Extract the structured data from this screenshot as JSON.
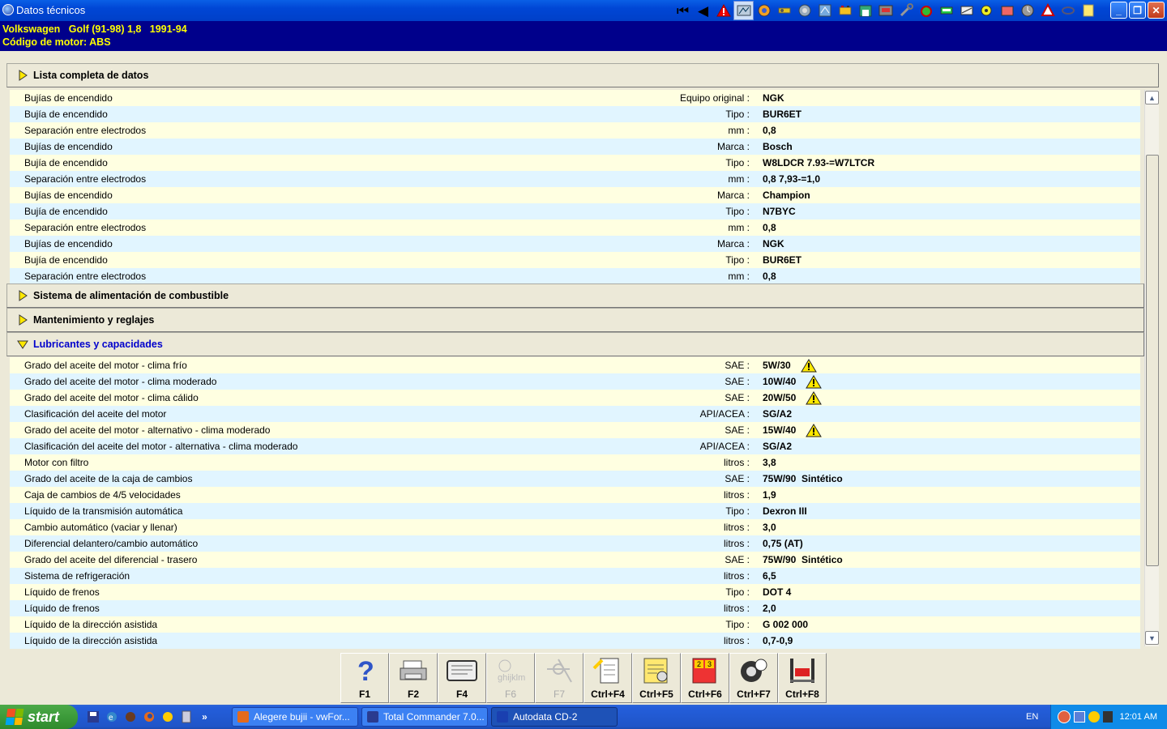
{
  "window": {
    "title": "Datos técnicos"
  },
  "toolbar": {
    "icons": [
      "first-page-icon",
      "previous-icon",
      "warning-icon",
      "diagram-icon",
      "engine-icon",
      "tools-icon",
      "disc-icon",
      "map-icon",
      "battery-icon",
      "garage-icon",
      "lift-icon",
      "wrench-icon",
      "electrical-icon",
      "car-icon",
      "belt-icon",
      "service-icon",
      "body-icon",
      "clock-icon",
      "triangle-icon",
      "chain-icon",
      "notes-icon"
    ]
  },
  "vehicle": {
    "line1": "Volkswagen   Golf (91-98) 1,8   1991-94",
    "line2": "Código de motor: ABS"
  },
  "sections": {
    "complete": "Lista completa de datos",
    "fuel": "Sistema de alimentación de combustible",
    "maintenance": "Mantenimiento y reglajes",
    "lubricants": "Lubricantes y capacidades"
  },
  "spark_rows": [
    {
      "name": "Bujías de encendido",
      "unit": "Equipo original :",
      "value": "NGK",
      "warn": false
    },
    {
      "name": "Bujía de encendido",
      "unit": "Tipo :",
      "value": "BUR6ET",
      "warn": false
    },
    {
      "name": "Separación entre electrodos",
      "unit": "mm :",
      "value": "0,8",
      "warn": false
    },
    {
      "name": "Bujías de encendido",
      "unit": "Marca :",
      "value": "Bosch",
      "warn": false
    },
    {
      "name": "Bujía de encendido",
      "unit": "Tipo :",
      "value": "W8LDCR 7.93-=W7LTCR",
      "warn": false
    },
    {
      "name": "Separación entre electrodos",
      "unit": "mm :",
      "value": "0,8 7,93-=1,0",
      "warn": false
    },
    {
      "name": "Bujías de encendido",
      "unit": "Marca :",
      "value": "Champion",
      "warn": false
    },
    {
      "name": "Bujía de encendido",
      "unit": "Tipo :",
      "value": "N7BYC",
      "warn": false
    },
    {
      "name": "Separación entre electrodos",
      "unit": "mm :",
      "value": "0,8",
      "warn": false
    },
    {
      "name": "Bujías de encendido",
      "unit": "Marca :",
      "value": "NGK",
      "warn": false
    },
    {
      "name": "Bujía de encendido",
      "unit": "Tipo :",
      "value": "BUR6ET",
      "warn": false
    },
    {
      "name": "Separación entre electrodos",
      "unit": "mm :",
      "value": "0,8",
      "warn": false
    }
  ],
  "lube_rows": [
    {
      "name": "Grado del aceite del motor - clima frío",
      "unit": "SAE :",
      "value": "5W/30",
      "warn": true
    },
    {
      "name": "Grado del aceite del motor - clima moderado",
      "unit": "SAE :",
      "value": "10W/40",
      "warn": true
    },
    {
      "name": "Grado del aceite del motor - clima cálido",
      "unit": "SAE :",
      "value": "20W/50",
      "warn": true
    },
    {
      "name": "Clasificación del aceite del motor",
      "unit": "API/ACEA :",
      "value": "SG/A2",
      "warn": false
    },
    {
      "name": "Grado del aceite del motor - alternativo - clima moderado",
      "unit": "SAE :",
      "value": "15W/40",
      "warn": true
    },
    {
      "name": "Clasificación del aceite del motor - alternativa - clima moderado",
      "unit": "API/ACEA :",
      "value": "SG/A2",
      "warn": false
    },
    {
      "name": "Motor con filtro",
      "unit": "litros :",
      "value": "3,8",
      "warn": false
    },
    {
      "name": "Grado del aceite de la caja de cambios",
      "unit": "SAE :",
      "value": "75W/90  Sintético",
      "warn": false
    },
    {
      "name": "Caja de cambios de 4/5 velocidades",
      "unit": "litros :",
      "value": "1,9",
      "warn": false
    },
    {
      "name": "Líquido de la transmisión automática",
      "unit": "Tipo :",
      "value": "Dexron III",
      "warn": false
    },
    {
      "name": "Cambio automático (vaciar y llenar)",
      "unit": "litros :",
      "value": "3,0",
      "warn": false
    },
    {
      "name": "Diferencial delantero/cambio automático",
      "unit": "litros :",
      "value": "0,75 (AT)",
      "warn": false
    },
    {
      "name": "Grado del aceite del diferencial - trasero",
      "unit": "SAE :",
      "value": "75W/90  Sintético",
      "warn": false
    },
    {
      "name": "Sistema de refrigeración",
      "unit": "litros :",
      "value": "6,5",
      "warn": false
    },
    {
      "name": "Líquido de frenos",
      "unit": "Tipo :",
      "value": "DOT 4",
      "warn": false
    },
    {
      "name": "Líquido de frenos",
      "unit": "litros :",
      "value": "2,0",
      "warn": false
    },
    {
      "name": "Líquido de la dirección asistida",
      "unit": "Tipo :",
      "value": "G 002 000",
      "warn": false
    },
    {
      "name": "Líquido de la dirección asistida",
      "unit": "litros :",
      "value": "0,7-0,9",
      "warn": false
    }
  ],
  "fkeys": [
    {
      "label": "F1",
      "icon": "help-icon",
      "enabled": true
    },
    {
      "label": "F2",
      "icon": "print-icon",
      "enabled": true
    },
    {
      "label": "F4",
      "icon": "screen-icon",
      "enabled": true
    },
    {
      "label": "F6",
      "icon": "abc-icon",
      "enabled": false
    },
    {
      "label": "F7",
      "icon": "compass-icon",
      "enabled": false
    },
    {
      "label": "Ctrl+F4",
      "icon": "document-icon",
      "enabled": true
    },
    {
      "label": "Ctrl+F5",
      "icon": "notes-icon",
      "enabled": true
    },
    {
      "label": "Ctrl+F6",
      "icon": "calendar-icon",
      "enabled": true
    },
    {
      "label": "Ctrl+F7",
      "icon": "tyre-icon",
      "enabled": true
    },
    {
      "label": "Ctrl+F8",
      "icon": "lift-icon",
      "enabled": true
    }
  ],
  "taskbar": {
    "start": "start",
    "tasks": [
      {
        "label": "Alegere bujii - vwFor...",
        "color": "#e46a1c",
        "active": false
      },
      {
        "label": "Total Commander 7.0...",
        "color": "#2a3b8f",
        "active": false
      },
      {
        "label": "Autodata CD-2",
        "color": "#1a3fb0",
        "active": true
      }
    ],
    "lang": "EN",
    "clock": "12:01 AM"
  },
  "colors": {
    "header_bg": "#00008B",
    "header_text": "#FFFF00",
    "row_odd": "#FFFFE1",
    "row_even": "#E1F5FF",
    "open_section": "#0000CC"
  }
}
